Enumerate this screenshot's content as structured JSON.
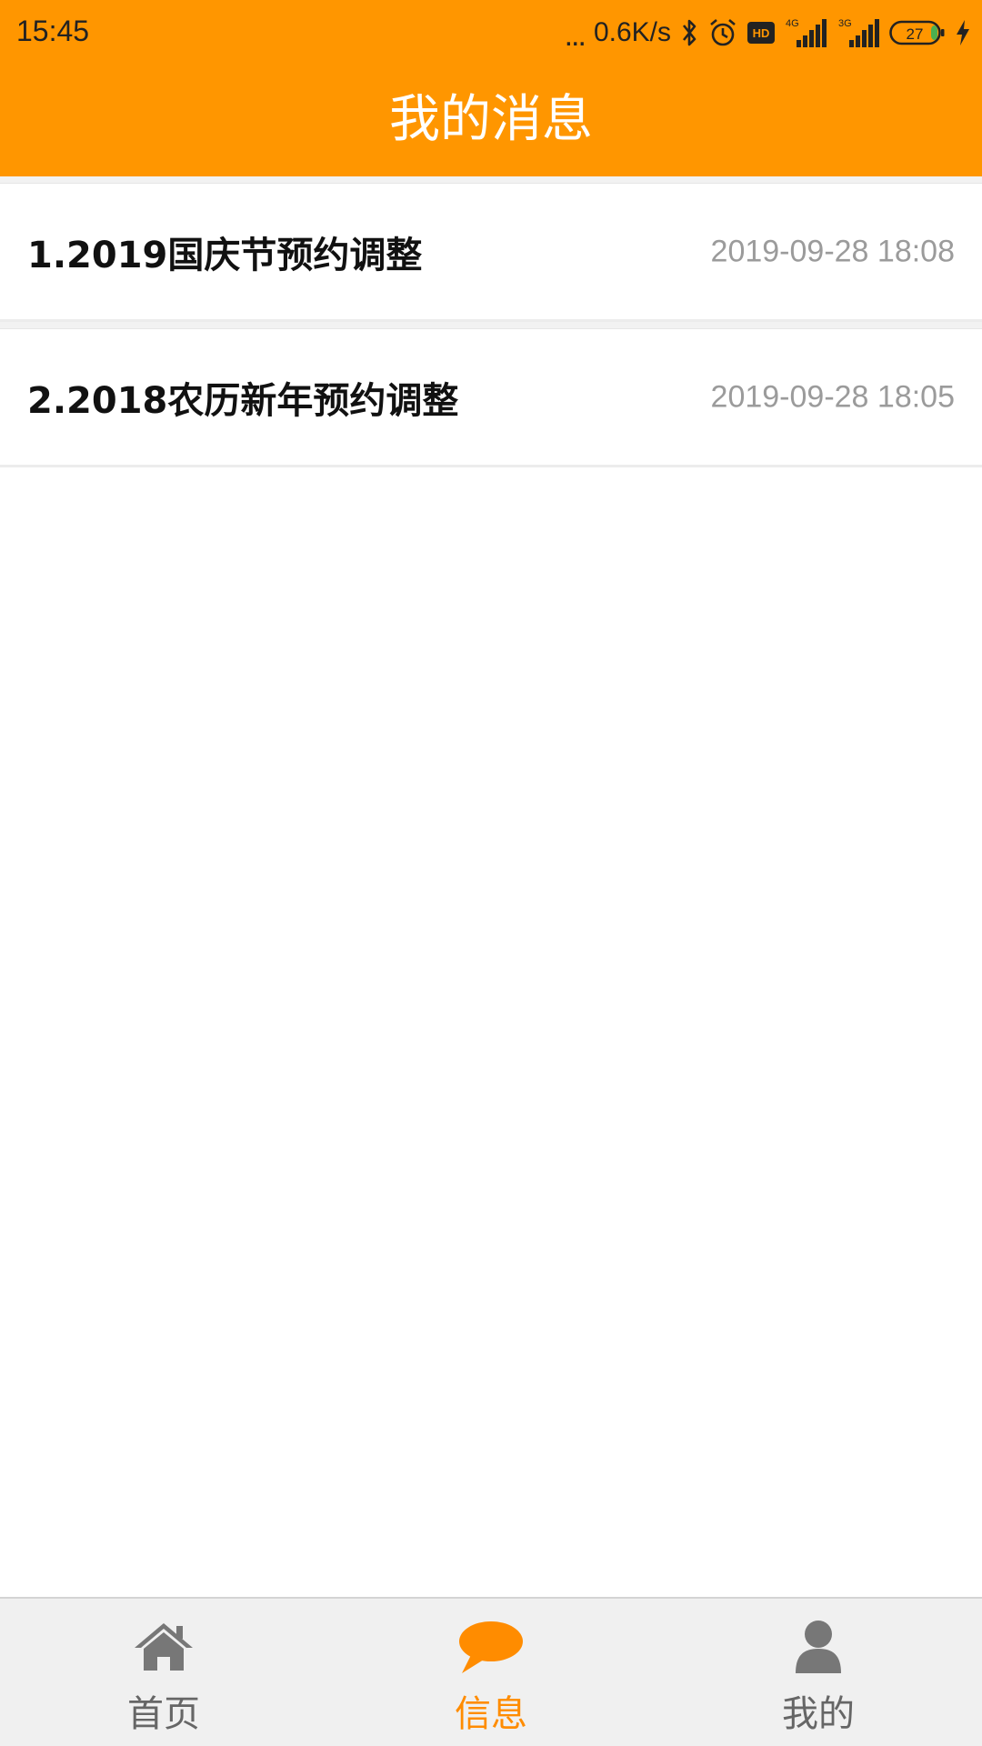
{
  "colors": {
    "accent": "#FF9600",
    "active_tab": "#FF8C00",
    "inactive_tab": "#666666",
    "timestamp": "#9b9b9b",
    "battery_fill": "#4CAF50"
  },
  "status_bar": {
    "time": "15:45",
    "dots": "...",
    "net_speed": "0.6K/s",
    "network_1": "4G",
    "network_2": "3G",
    "battery": "27",
    "icons": [
      "bluetooth-icon",
      "alarm-icon",
      "hd-icon",
      "signal-4g-icon",
      "signal-3g-icon",
      "battery-icon",
      "charging-icon"
    ]
  },
  "header": {
    "title": "我的消息"
  },
  "messages": [
    {
      "title": "1.2019国庆节预约调整",
      "time": "2019-09-28 18:08"
    },
    {
      "title": "2.2018农历新年预约调整",
      "time": "2019-09-28 18:05"
    }
  ],
  "tabbar": {
    "tabs": [
      {
        "label": "首页",
        "icon": "home-icon",
        "active": false
      },
      {
        "label": "信息",
        "icon": "chat-bubble-icon",
        "active": true
      },
      {
        "label": "我的",
        "icon": "user-icon",
        "active": false
      }
    ]
  }
}
